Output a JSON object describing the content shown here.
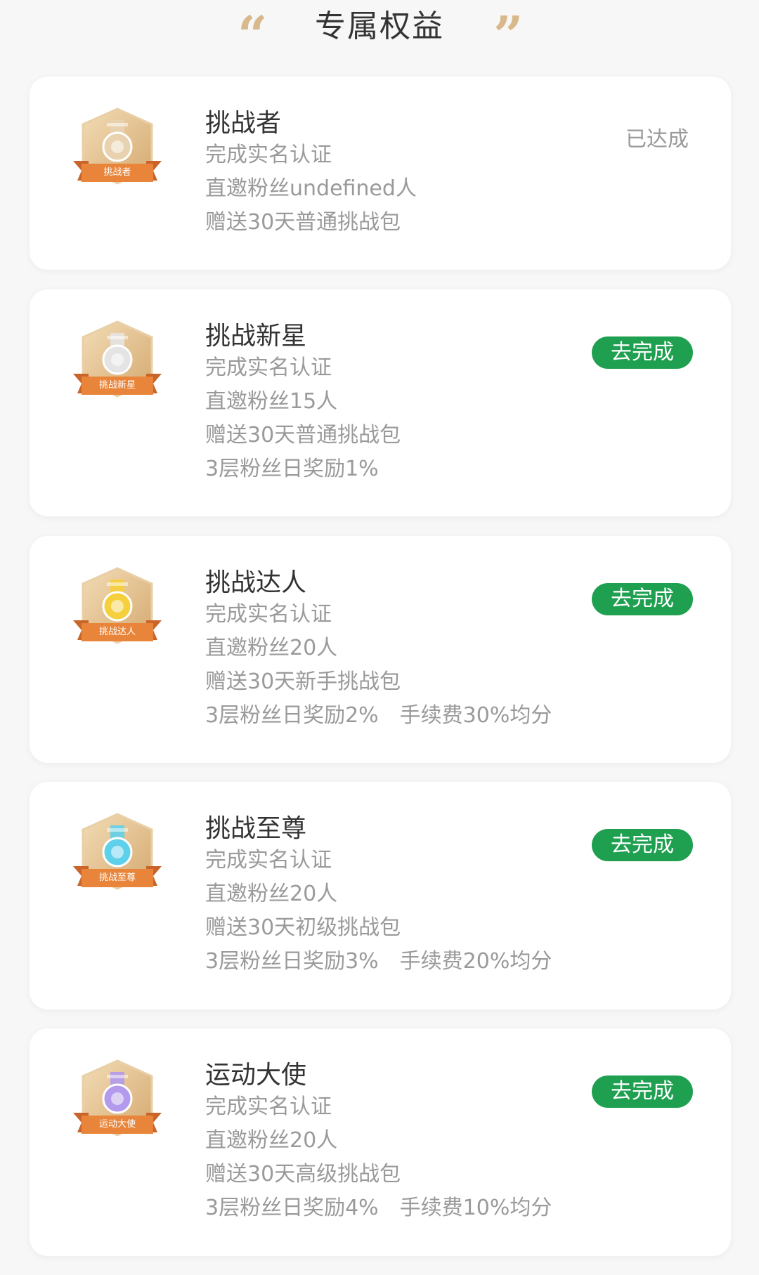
{
  "header": {
    "title": "专属权益",
    "quote_open": "“",
    "quote_close": "”"
  },
  "colors": {
    "accent_green": "#1fa050",
    "gold": "#d9b98c",
    "ribbon_orange": "#e8853a"
  },
  "tiers": [
    {
      "badge_label": "挑战者",
      "medal_color": "#e8d2b0",
      "title": "挑战者",
      "benefits": [
        "完成实名认证",
        "直邀粉丝undefined人",
        "赠送30天普通挑战包"
      ],
      "status": "已达成",
      "status_type": "done"
    },
    {
      "badge_label": "挑战新星",
      "medal_color": "#e4e4e4",
      "title": "挑战新星",
      "benefits": [
        "完成实名认证",
        "直邀粉丝15人",
        "赠送30天普通挑战包",
        "3层粉丝日奖励1%"
      ],
      "status": "去完成",
      "status_type": "todo"
    },
    {
      "badge_label": "挑战达人",
      "medal_color": "#f5cf3c",
      "title": "挑战达人",
      "benefits": [
        "完成实名认证",
        "直邀粉丝20人",
        "赠送30天新手挑战包",
        "3层粉丝日奖励2%　手续费30%均分"
      ],
      "status": "去完成",
      "status_type": "todo"
    },
    {
      "badge_label": "挑战至尊",
      "medal_color": "#5fd0ea",
      "title": "挑战至尊",
      "benefits": [
        "完成实名认证",
        "直邀粉丝20人",
        "赠送30天初级挑战包",
        "3层粉丝日奖励3%　手续费20%均分"
      ],
      "status": "去完成",
      "status_type": "todo"
    },
    {
      "badge_label": "运动大使",
      "medal_color": "#b39aec",
      "title": "运动大使",
      "benefits": [
        "完成实名认证",
        "直邀粉丝20人",
        "赠送30天高级挑战包",
        "3层粉丝日奖励4%　手续费10%均分"
      ],
      "status": "去完成",
      "status_type": "todo"
    }
  ]
}
